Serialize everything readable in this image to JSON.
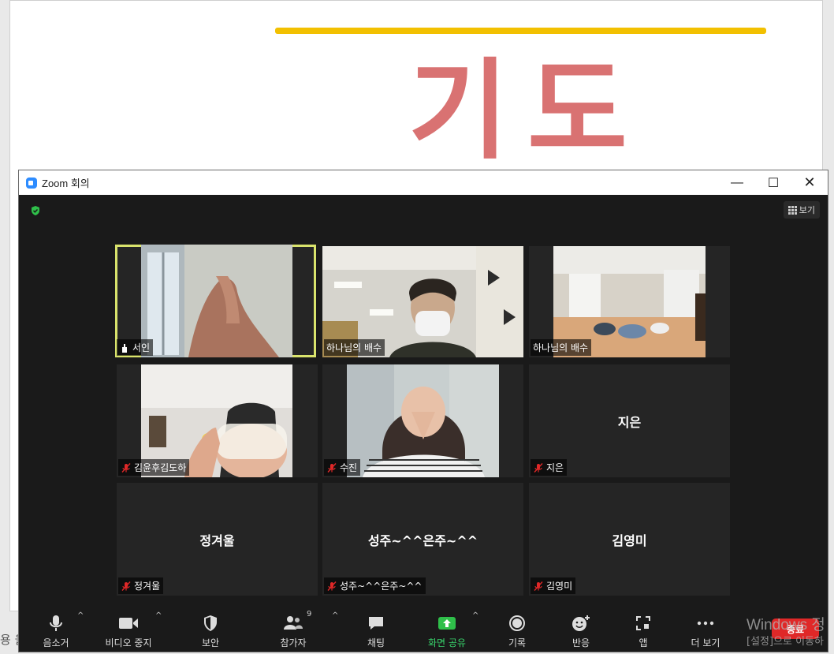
{
  "document": {
    "slide_title": "기도",
    "bottom_text": "용 을"
  },
  "window": {
    "title": "Zoom 회의",
    "minimize": "—",
    "maximize": "☐",
    "close": "✕"
  },
  "view_button": "보기",
  "tiles": [
    {
      "name": "서인",
      "type": "video",
      "muted": false,
      "active": true
    },
    {
      "name": "하나님의 배수",
      "type": "video",
      "muted": false
    },
    {
      "name": "하나님의 배수",
      "type": "video",
      "muted": false
    },
    {
      "name": "김윤후김도하",
      "type": "video",
      "muted": true
    },
    {
      "name": "수진",
      "type": "video",
      "muted": true
    },
    {
      "name": "지은",
      "display": "지은",
      "type": "name",
      "muted": true
    },
    {
      "name": "정겨울",
      "display": "정겨울",
      "type": "name",
      "muted": true
    },
    {
      "name": "성주~^^은주~^^",
      "display": "성주~^^은주~^^",
      "type": "name",
      "muted": true
    },
    {
      "name": "김영미",
      "display": "김영미",
      "type": "name",
      "muted": true
    }
  ],
  "toolbar": {
    "mute": "음소거",
    "stop_video": "비디오 중지",
    "security": "보안",
    "participants": "참가자",
    "participants_count": "9",
    "chat": "채팅",
    "share_screen": "화면 공유",
    "record": "기록",
    "reactions": "반응",
    "apps": "앱",
    "more": "더 보기",
    "end": "종료"
  },
  "watermark": {
    "line1": "Windows 정",
    "line2": "[설정]으로 이동하"
  },
  "colors": {
    "active_speaker": "#d9e36c",
    "share_green": "#38d26b",
    "end_red": "#e02828",
    "slide_title": "#d97272",
    "slide_bar": "#f2c000"
  }
}
